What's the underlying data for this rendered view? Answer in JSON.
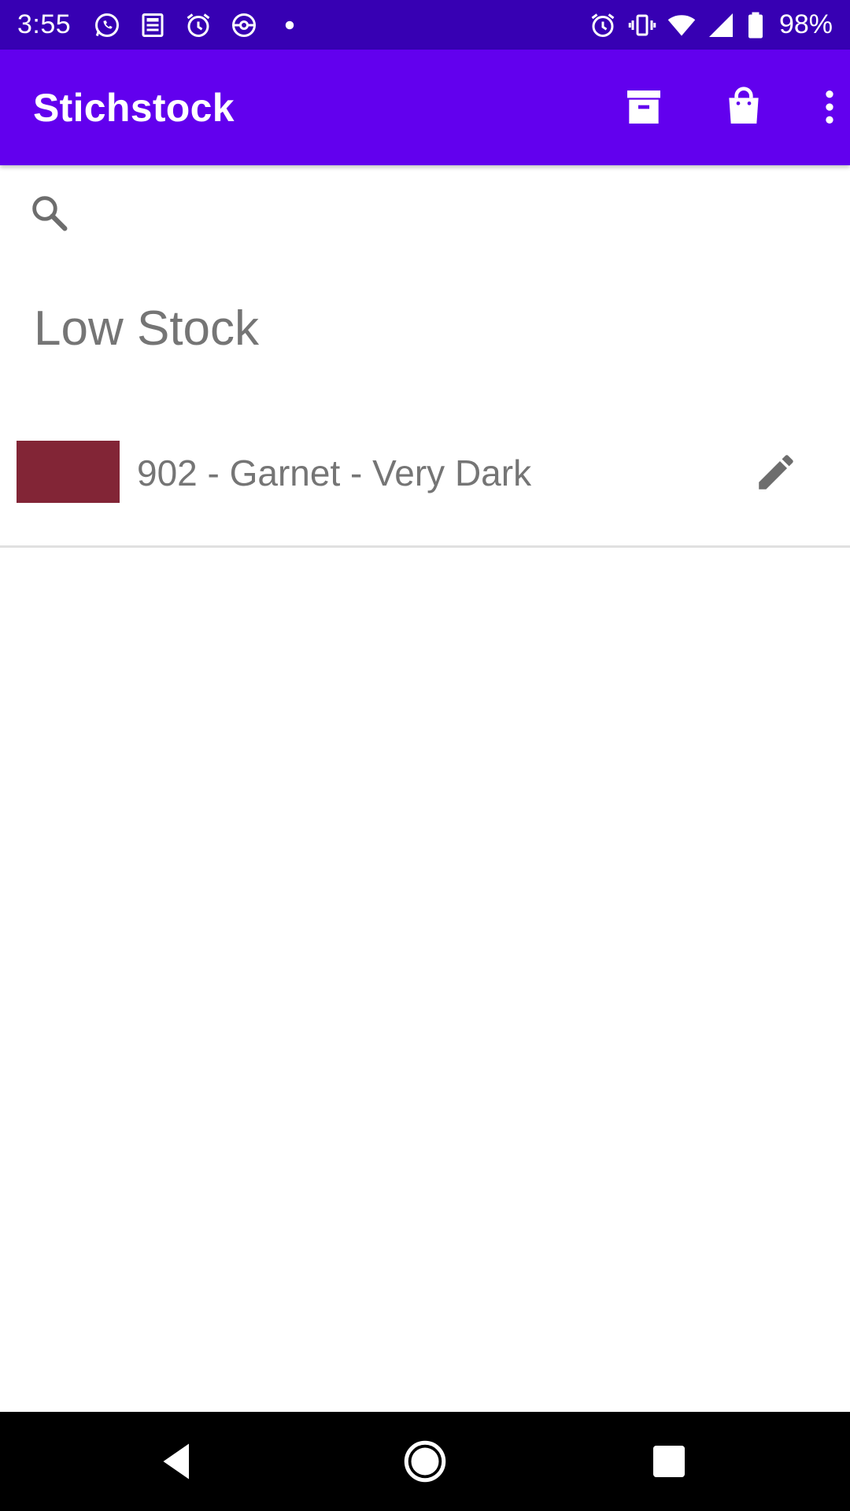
{
  "status_bar": {
    "time": "3:55",
    "battery": "98%",
    "left_icons": [
      "whatsapp-icon",
      "news-icon",
      "alarm-icon",
      "pokeball-icon",
      "dot-icon"
    ],
    "right_icons": [
      "alarm-icon",
      "vibrate-icon",
      "wifi-icon",
      "signal-icon",
      "battery-icon"
    ]
  },
  "app_bar": {
    "title": "Stichstock",
    "actions": [
      "archive-icon",
      "shopping-bag-icon",
      "more-vert-icon"
    ]
  },
  "search": {
    "placeholder": "",
    "value": ""
  },
  "section": {
    "title": "Low Stock"
  },
  "items": [
    {
      "label": "902 - Garnet - Very Dark",
      "swatch_color": "#822536"
    }
  ],
  "colors": {
    "status_bar": "#3700B3",
    "app_bar": "#6200EE",
    "text_secondary": "#757575",
    "icon_gray": "#6d6d6d"
  }
}
